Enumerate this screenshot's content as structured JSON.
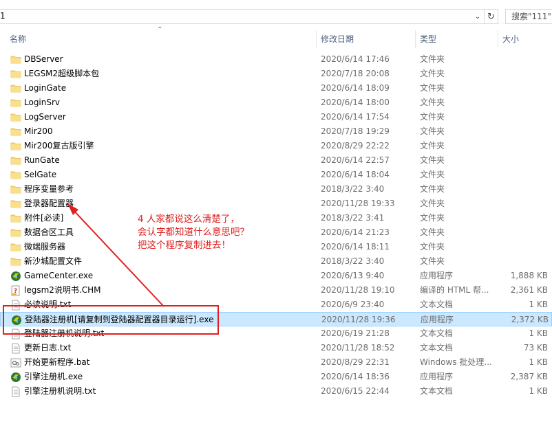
{
  "address": {
    "path": "1"
  },
  "search": {
    "placeholder": "搜索\"111\""
  },
  "columns": {
    "name": "名称",
    "date": "修改日期",
    "type": "类型",
    "size": "大小"
  },
  "files": [
    {
      "name": "DBServer",
      "date": "2020/6/14 17:46",
      "type": "文件夹",
      "size": "",
      "icon": "folder-icon"
    },
    {
      "name": "LEGSM2超级脚本包",
      "date": "2020/7/18 20:08",
      "type": "文件夹",
      "size": "",
      "icon": "folder-icon"
    },
    {
      "name": "LoginGate",
      "date": "2020/6/14 18:09",
      "type": "文件夹",
      "size": "",
      "icon": "folder-icon"
    },
    {
      "name": "LoginSrv",
      "date": "2020/6/14 18:00",
      "type": "文件夹",
      "size": "",
      "icon": "folder-icon"
    },
    {
      "name": "LogServer",
      "date": "2020/6/14 17:54",
      "type": "文件夹",
      "size": "",
      "icon": "folder-icon"
    },
    {
      "name": "Mir200",
      "date": "2020/7/18 19:29",
      "type": "文件夹",
      "size": "",
      "icon": "folder-icon"
    },
    {
      "name": "Mir200复古版引擎",
      "date": "2020/8/29 22:22",
      "type": "文件夹",
      "size": "",
      "icon": "folder-icon"
    },
    {
      "name": "RunGate",
      "date": "2020/6/14 22:57",
      "type": "文件夹",
      "size": "",
      "icon": "folder-icon"
    },
    {
      "name": "SelGate",
      "date": "2020/6/14 18:04",
      "type": "文件夹",
      "size": "",
      "icon": "folder-icon"
    },
    {
      "name": "程序变量参考",
      "date": "2018/3/22 3:40",
      "type": "文件夹",
      "size": "",
      "icon": "folder-icon"
    },
    {
      "name": "登录器配置器",
      "date": "2020/11/28 19:33",
      "type": "文件夹",
      "size": "",
      "icon": "folder-icon"
    },
    {
      "name": "附件[必读]",
      "date": "2018/3/22 3:41",
      "type": "文件夹",
      "size": "",
      "icon": "folder-icon"
    },
    {
      "name": "数据合区工具",
      "date": "2020/6/14 21:23",
      "type": "文件夹",
      "size": "",
      "icon": "folder-icon"
    },
    {
      "name": "微端服务器",
      "date": "2020/6/14 18:11",
      "type": "文件夹",
      "size": "",
      "icon": "folder-icon"
    },
    {
      "name": "新沙城配置文件",
      "date": "2018/3/22 3:40",
      "type": "文件夹",
      "size": "",
      "icon": "folder-icon"
    },
    {
      "name": "GameCenter.exe",
      "date": "2020/6/13 9:40",
      "type": "应用程序",
      "size": "1,888 KB",
      "icon": "exe-icon"
    },
    {
      "name": "legsm2说明书.CHM",
      "date": "2020/11/28 19:10",
      "type": "编译的 HTML 帮...",
      "size": "2,361 KB",
      "icon": "chm-icon"
    },
    {
      "name": "必读说明.txt",
      "date": "2020/6/9 23:40",
      "type": "文本文档",
      "size": "1 KB",
      "icon": "txt-icon"
    },
    {
      "name": "登陆器注册机[请复制到登陆器配置器目录运行].exe",
      "date": "2020/11/28 19:36",
      "type": "应用程序",
      "size": "2,372 KB",
      "icon": "exe-icon"
    },
    {
      "name": "登陆器注册机说明.txt",
      "date": "2020/6/19 21:28",
      "type": "文本文档",
      "size": "1 KB",
      "icon": "txt-icon"
    },
    {
      "name": "更新日志.txt",
      "date": "2020/11/28 18:52",
      "type": "文本文档",
      "size": "73 KB",
      "icon": "txt-icon"
    },
    {
      "name": "开始更新程序.bat",
      "date": "2020/8/29 22:31",
      "type": "Windows 批处理...",
      "size": "1 KB",
      "icon": "bat-icon"
    },
    {
      "name": "引擎注册机.exe",
      "date": "2020/6/14 18:36",
      "type": "应用程序",
      "size": "2,387 KB",
      "icon": "exe-icon"
    },
    {
      "name": "引擎注册机说明.txt",
      "date": "2020/6/15 22:44",
      "type": "文本文档",
      "size": "1 KB",
      "icon": "txt-icon"
    }
  ],
  "selected_index": 18,
  "annotation": {
    "lines": [
      "4 人家都说这么清楚了，",
      "会认字都知道什么意思吧？",
      "把这个程序复制进去！"
    ],
    "color": "#e02020"
  }
}
